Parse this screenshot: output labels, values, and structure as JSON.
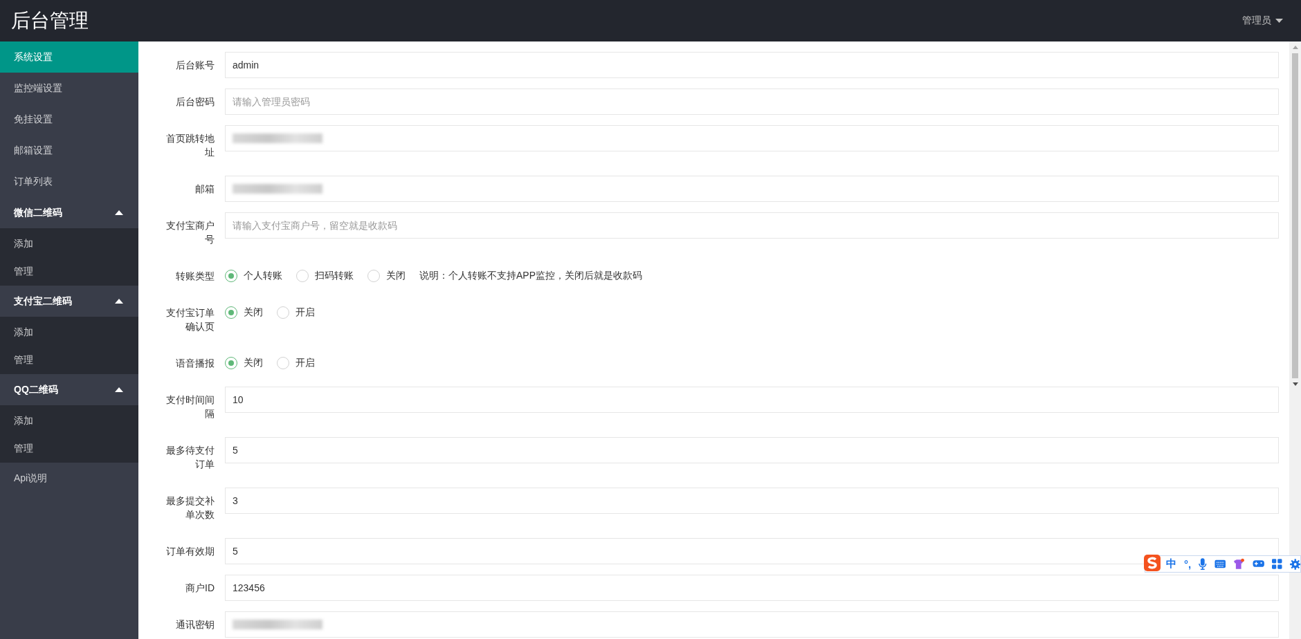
{
  "header": {
    "title": "后台管理",
    "user": "管理员"
  },
  "sidebar": {
    "items": [
      {
        "label": "系统设置",
        "selected": true
      },
      {
        "label": "监控端设置",
        "selected": false
      },
      {
        "label": "免挂设置",
        "selected": false
      },
      {
        "label": "邮箱设置",
        "selected": false
      },
      {
        "label": "订单列表",
        "selected": false
      },
      {
        "label": "微信二维码",
        "selected": false,
        "expanded": true,
        "children": [
          {
            "label": "添加",
            "selected": false
          },
          {
            "label": "管理",
            "selected": false
          }
        ]
      },
      {
        "label": "支付宝二维码",
        "selected": false,
        "expanded": true,
        "children": [
          {
            "label": "添加",
            "selected": false
          },
          {
            "label": "管理",
            "selected": false
          }
        ]
      },
      {
        "label": "QQ二维码",
        "selected": false,
        "expanded": true,
        "children": [
          {
            "label": "添加",
            "selected": false
          },
          {
            "label": "管理",
            "selected": false
          }
        ]
      },
      {
        "label": "Api说明",
        "selected": false
      }
    ]
  },
  "form": {
    "fields": [
      {
        "kind": "input",
        "label": "后台账号",
        "value": "admin"
      },
      {
        "kind": "input",
        "label": "后台密码",
        "placeholder": "请输入管理员密码"
      },
      {
        "kind": "blurred",
        "label": "首页跳转地址"
      },
      {
        "kind": "blurred",
        "label": "邮箱"
      },
      {
        "kind": "input",
        "label": "支付宝商户号",
        "placeholder": "请输入支付宝商户号，留空就是收款码"
      },
      {
        "kind": "radio",
        "label": "转账类型",
        "options": [
          {
            "label": "个人转账",
            "selected": true
          },
          {
            "label": "扫码转账",
            "selected": false
          },
          {
            "label": "关闭",
            "selected": false
          }
        ],
        "note": "说明：个人转账不支持APP监控，关闭后就是收款码"
      },
      {
        "kind": "radio",
        "label": "支付宝订单确认页",
        "options": [
          {
            "label": "关闭",
            "selected": true
          },
          {
            "label": "开启",
            "selected": false
          }
        ]
      },
      {
        "kind": "radio",
        "label": "语音播报",
        "options": [
          {
            "label": "关闭",
            "selected": true
          },
          {
            "label": "开启",
            "selected": false
          }
        ]
      },
      {
        "kind": "input",
        "label": "支付时间间隔",
        "value": "10"
      },
      {
        "kind": "input",
        "label": "最多待支付订单",
        "value": "5"
      },
      {
        "kind": "input",
        "label": "最多提交补单次数",
        "value": "3"
      },
      {
        "kind": "input",
        "label": "订单有效期",
        "value": "5"
      },
      {
        "kind": "input",
        "label": "商户ID",
        "value": "123456"
      },
      {
        "kind": "blurred",
        "label": "通讯密钥"
      }
    ]
  },
  "ime_toolbar": {
    "mode": "中",
    "punctuation": "°,"
  }
}
